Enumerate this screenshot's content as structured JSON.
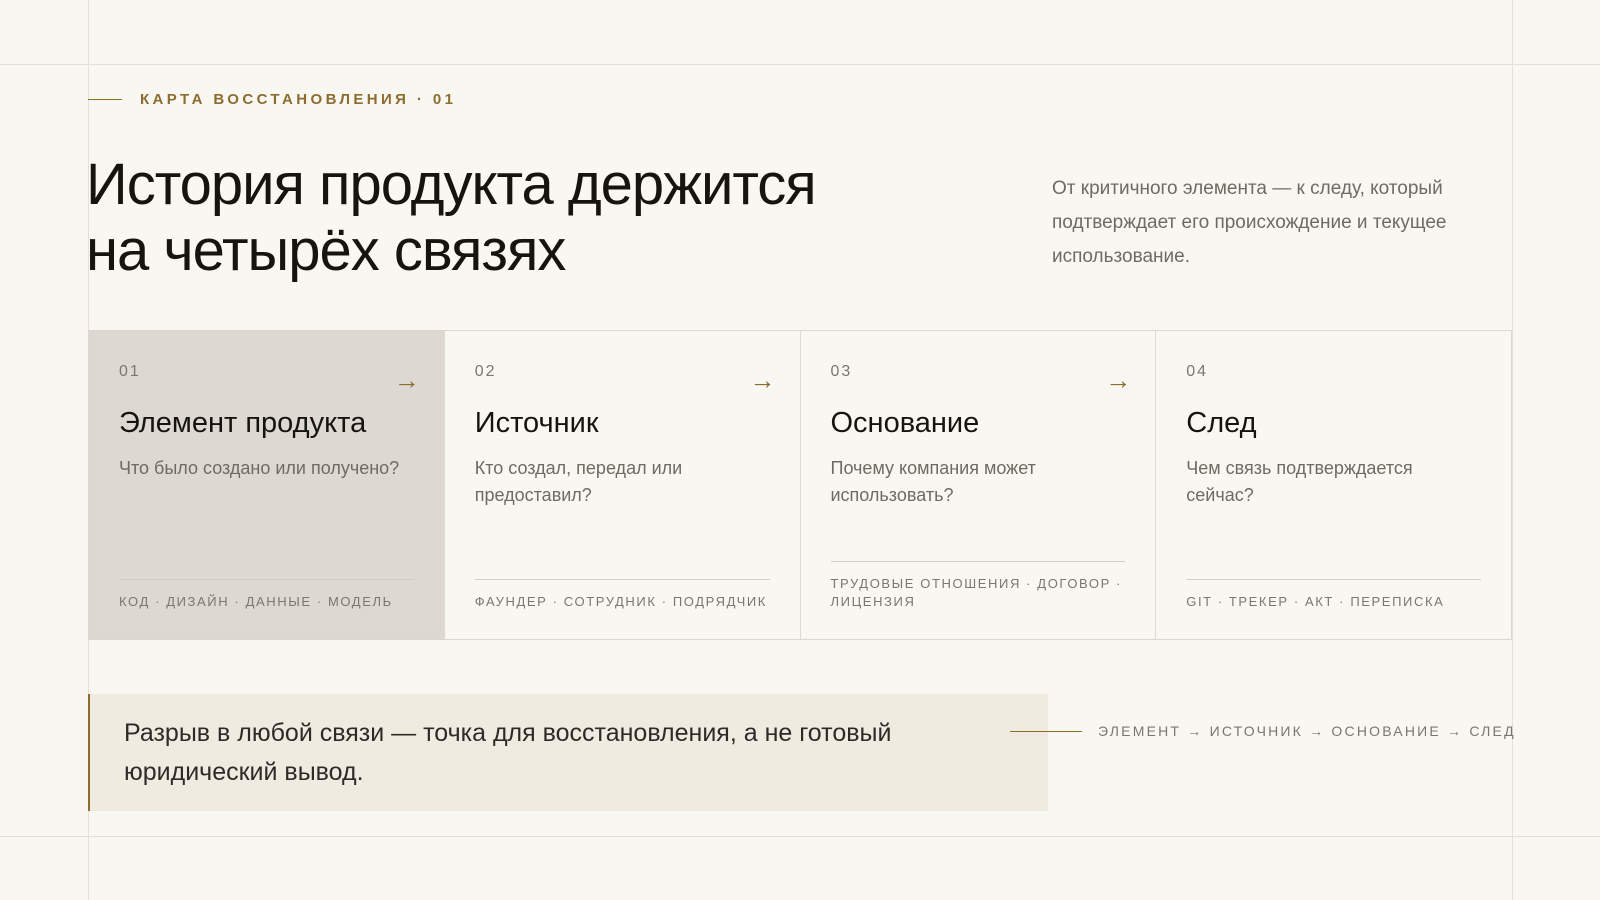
{
  "eyebrow": "КАРТА ВОССТАНОВЛЕНИЯ · 01",
  "headline": {
    "line1": "История продукта держится",
    "line2": "на четырёх связях"
  },
  "lede": "От критичного элемента — к следу, который подтверждает его происхождение и текущее использование.",
  "cards": [
    {
      "num": "01",
      "arrow": "→",
      "title": "Элемент продукта",
      "desc": "Что было создано или получено?",
      "tags": "КОД · ДИЗАЙН · ДАННЫЕ · МОДЕЛЬ"
    },
    {
      "num": "02",
      "arrow": "→",
      "title": "Источник",
      "desc": "Кто создал, передал или предоставил?",
      "tags": "ФАУНДЕР · СОТРУДНИК · ПОДРЯДЧИК"
    },
    {
      "num": "03",
      "arrow": "→",
      "title": "Основание",
      "desc": "Почему компания может использовать?",
      "tags": "ТРУДОВЫЕ ОТНОШЕНИЯ · ДОГОВОР · ЛИЦЕНЗИЯ"
    },
    {
      "num": "04",
      "title": "След",
      "desc": "Чем связь подтверждается сейчас?",
      "tags": "GIT · ТРЕКЕР · АКТ · ПЕРЕПИСКА"
    }
  ],
  "callout": "Разрыв в любой связи — точка для восстановления, а не готовый юридический вывод.",
  "chain": "ЭЛЕМЕНТ → ИСТОЧНИК → ОСНОВАНИЕ → СЛЕД",
  "colors": {
    "accent": "#8d6d2f",
    "background": "#f9f7f2",
    "active_card": "#ddd9d2",
    "callout_bg": "#f0ebe1",
    "muted_text": "#6f6a62"
  },
  "icons": {
    "card_arrow": "arrow-right-icon"
  }
}
